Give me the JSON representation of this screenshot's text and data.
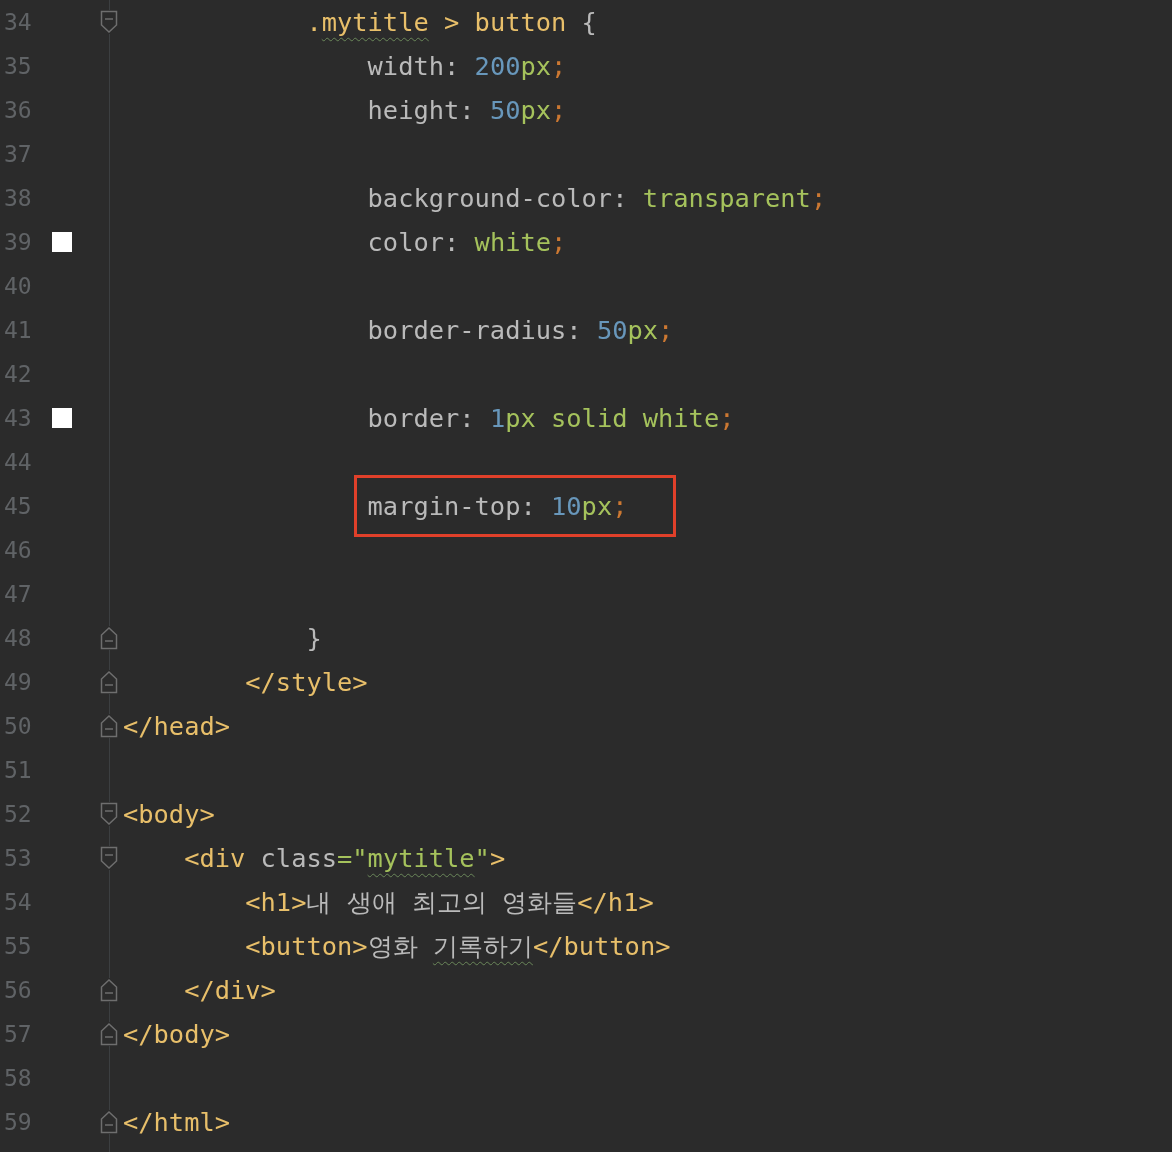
{
  "editor": {
    "lines": [
      {
        "number": "34",
        "fold_start": true,
        "fold_end": false,
        "swatch": false,
        "highlighted": false,
        "tokens": [
          {
            "text": "            .",
            "kind": "tag"
          },
          {
            "text": "mytitle",
            "kind": "tag",
            "typo": true
          },
          {
            "text": " > ",
            "kind": "tag"
          },
          {
            "text": "button",
            "kind": "tag"
          },
          {
            "text": " {",
            "kind": "plain"
          }
        ]
      },
      {
        "number": "35",
        "fold_start": false,
        "fold_end": false,
        "swatch": false,
        "highlighted": false,
        "tokens": [
          {
            "text": "                width",
            "kind": "plain"
          },
          {
            "text": ": ",
            "kind": "plain"
          },
          {
            "text": "200",
            "kind": "number"
          },
          {
            "text": "px",
            "kind": "value"
          },
          {
            "text": ";",
            "kind": "punct"
          }
        ]
      },
      {
        "number": "36",
        "fold_start": false,
        "fold_end": false,
        "swatch": false,
        "highlighted": false,
        "tokens": [
          {
            "text": "                height",
            "kind": "plain"
          },
          {
            "text": ": ",
            "kind": "plain"
          },
          {
            "text": "50",
            "kind": "number"
          },
          {
            "text": "px",
            "kind": "value"
          },
          {
            "text": ";",
            "kind": "punct"
          }
        ]
      },
      {
        "number": "37",
        "fold_start": false,
        "fold_end": false,
        "swatch": false,
        "highlighted": false
      },
      {
        "number": "38",
        "fold_start": false,
        "fold_end": false,
        "swatch": false,
        "highlighted": false,
        "tokens": [
          {
            "text": "                background-color",
            "kind": "plain"
          },
          {
            "text": ": ",
            "kind": "plain"
          },
          {
            "text": "transparent",
            "kind": "value"
          },
          {
            "text": ";",
            "kind": "punct"
          }
        ]
      },
      {
        "number": "39",
        "fold_start": false,
        "fold_end": false,
        "swatch": true,
        "highlighted": false,
        "tokens": [
          {
            "text": "                color",
            "kind": "plain"
          },
          {
            "text": ": ",
            "kind": "plain"
          },
          {
            "text": "white",
            "kind": "value"
          },
          {
            "text": ";",
            "kind": "punct"
          }
        ]
      },
      {
        "number": "40",
        "fold_start": false,
        "fold_end": false,
        "swatch": false,
        "highlighted": false
      },
      {
        "number": "41",
        "fold_start": false,
        "fold_end": false,
        "swatch": false,
        "highlighted": false,
        "tokens": [
          {
            "text": "                border-radius",
            "kind": "plain"
          },
          {
            "text": ": ",
            "kind": "plain"
          },
          {
            "text": "50",
            "kind": "number"
          },
          {
            "text": "px",
            "kind": "value"
          },
          {
            "text": ";",
            "kind": "punct"
          }
        ]
      },
      {
        "number": "42",
        "fold_start": false,
        "fold_end": false,
        "swatch": false,
        "highlighted": false
      },
      {
        "number": "43",
        "fold_start": false,
        "fold_end": false,
        "swatch": true,
        "highlighted": false,
        "tokens": [
          {
            "text": "                border",
            "kind": "plain"
          },
          {
            "text": ": ",
            "kind": "plain"
          },
          {
            "text": "1",
            "kind": "number"
          },
          {
            "text": "px solid white",
            "kind": "value"
          },
          {
            "text": ";",
            "kind": "punct"
          }
        ]
      },
      {
        "number": "44",
        "fold_start": false,
        "fold_end": false,
        "swatch": false,
        "highlighted": false
      },
      {
        "number": "45",
        "fold_start": false,
        "fold_end": false,
        "swatch": false,
        "highlighted": true,
        "tokens": [
          {
            "text": "                margin-top",
            "kind": "plain"
          },
          {
            "text": ": ",
            "kind": "plain"
          },
          {
            "text": "10",
            "kind": "number"
          },
          {
            "text": "px",
            "kind": "value"
          },
          {
            "text": ";",
            "kind": "punct"
          }
        ]
      },
      {
        "number": "46",
        "fold_start": false,
        "fold_end": false,
        "swatch": false,
        "highlighted": false
      },
      {
        "number": "47",
        "fold_start": false,
        "fold_end": false,
        "swatch": false,
        "highlighted": false
      },
      {
        "number": "48",
        "fold_start": false,
        "fold_end": true,
        "swatch": false,
        "highlighted": false,
        "tokens": [
          {
            "text": "            }",
            "kind": "plain"
          }
        ]
      },
      {
        "number": "49",
        "fold_start": false,
        "fold_end": true,
        "swatch": false,
        "highlighted": false,
        "tokens": [
          {
            "text": "        </style>",
            "kind": "tag"
          }
        ]
      },
      {
        "number": "50",
        "fold_start": false,
        "fold_end": true,
        "swatch": false,
        "highlighted": false,
        "tokens": [
          {
            "text": "</head>",
            "kind": "tag"
          }
        ]
      },
      {
        "number": "51",
        "fold_start": false,
        "fold_end": false,
        "swatch": false,
        "highlighted": false
      },
      {
        "number": "52",
        "fold_start": true,
        "fold_end": false,
        "swatch": false,
        "highlighted": false,
        "tokens": [
          {
            "text": "<body>",
            "kind": "tag"
          }
        ]
      },
      {
        "number": "53",
        "fold_start": true,
        "fold_end": false,
        "swatch": false,
        "highlighted": false,
        "tokens": [
          {
            "text": "    <div ",
            "kind": "tag"
          },
          {
            "text": "class",
            "kind": "plain"
          },
          {
            "text": "=\"",
            "kind": "value"
          },
          {
            "text": "mytitle",
            "kind": "value",
            "typo": true
          },
          {
            "text": "\"",
            "kind": "value"
          },
          {
            "text": ">",
            "kind": "tag"
          }
        ]
      },
      {
        "number": "54",
        "fold_start": false,
        "fold_end": false,
        "swatch": false,
        "highlighted": false,
        "tokens": [
          {
            "text": "        <h1>",
            "kind": "tag"
          },
          {
            "text": "내 생애 최고의 영화들",
            "kind": "plain"
          },
          {
            "text": "</h1>",
            "kind": "tag"
          }
        ]
      },
      {
        "number": "55",
        "fold_start": false,
        "fold_end": false,
        "swatch": false,
        "highlighted": false,
        "tokens": [
          {
            "text": "        <button>",
            "kind": "tag"
          },
          {
            "text": "영화 ",
            "kind": "plain"
          },
          {
            "text": "기록하기",
            "kind": "plain",
            "typo": true
          },
          {
            "text": "</button>",
            "kind": "tag"
          }
        ]
      },
      {
        "number": "56",
        "fold_start": false,
        "fold_end": true,
        "swatch": false,
        "highlighted": false,
        "tokens": [
          {
            "text": "    </div>",
            "kind": "tag"
          }
        ]
      },
      {
        "number": "57",
        "fold_start": false,
        "fold_end": true,
        "swatch": false,
        "highlighted": false,
        "tokens": [
          {
            "text": "</body>",
            "kind": "tag"
          }
        ]
      },
      {
        "number": "58",
        "fold_start": false,
        "fold_end": false,
        "swatch": false,
        "highlighted": false
      },
      {
        "number": "59",
        "fold_start": false,
        "fold_end": true,
        "swatch": false,
        "highlighted": false,
        "tokens": [
          {
            "text": "</html>",
            "kind": "tag"
          }
        ]
      }
    ]
  }
}
